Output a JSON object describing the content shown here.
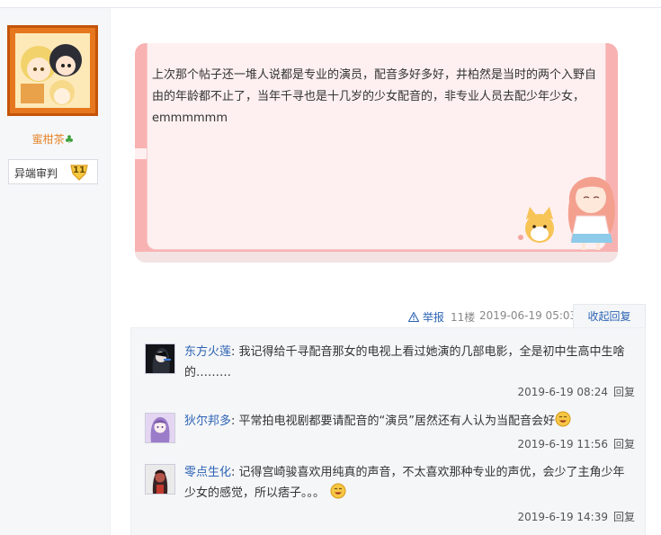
{
  "user": {
    "name": "蜜柑茶",
    "badge_title": "异端审判",
    "badge_level": "11"
  },
  "post": {
    "text": "上次那个帖子还一堆人说都是专业的演员，配音多好多好，井柏然是当时的两个入野自由的年龄都不止了，当年千寻也是十几岁的少女配音的，非专业人员去配少年少女，emmmmmm"
  },
  "meta": {
    "report_label": "举报",
    "floor": "11楼",
    "time": "2019-06-19 05:03",
    "collapse_label": "收起回复"
  },
  "replies": [
    {
      "name": "东方火莲",
      "text": "我记得给千寻配音那女的电视上看过她演的几部电影，全是初中生高中生啥的………",
      "time": "2019-6-19 08:24",
      "reply_label": "回复"
    },
    {
      "name": "狄尔邦多",
      "text": "平常拍电视剧都要请配音的“演员”居然还有人认为当配音会好",
      "time": "2019-6-19 11:56",
      "reply_label": "回复",
      "emoji": "smile-emoji"
    },
    {
      "name": "零点生化",
      "text": "记得宫崎骏喜欢用纯真的声音，不太喜欢那种专业的声优，会少了主角少年少女的感觉，所以痞子。。。",
      "time": "2019-6-19 14:39",
      "reply_label": "回复",
      "emoji": "smile-emoji"
    }
  ],
  "colors": {
    "link": "#2d64b3",
    "username": "#e6852a",
    "bubble_border": "#f9b2b2",
    "bubble_fill": "#fef0f0"
  }
}
